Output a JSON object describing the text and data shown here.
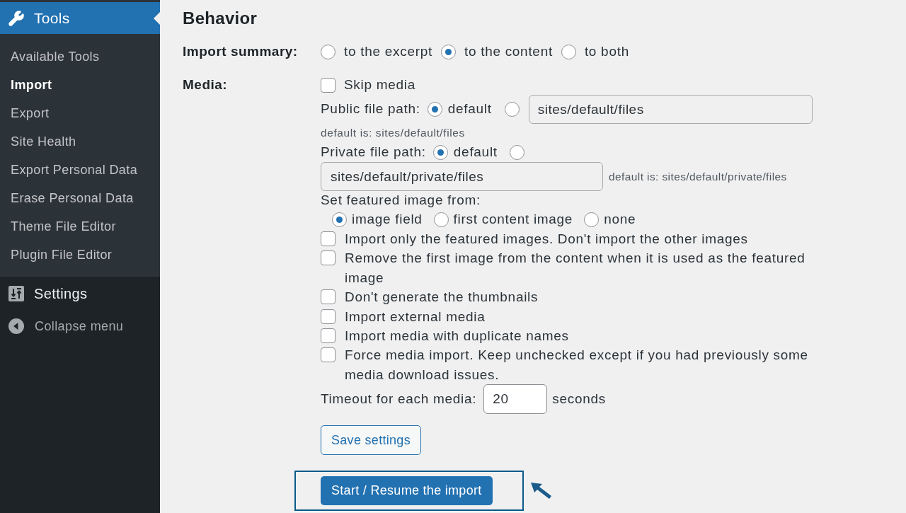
{
  "sidebar": {
    "menu_header": {
      "label": "Tools"
    },
    "submenu": [
      {
        "label": "Available Tools",
        "selected": false
      },
      {
        "label": "Import",
        "selected": true
      },
      {
        "label": "Export",
        "selected": false
      },
      {
        "label": "Site Health",
        "selected": false
      },
      {
        "label": "Export Personal Data",
        "selected": false
      },
      {
        "label": "Erase Personal Data",
        "selected": false
      },
      {
        "label": "Theme File Editor",
        "selected": false
      },
      {
        "label": "Plugin File Editor",
        "selected": false
      }
    ],
    "menu_items": [
      {
        "kind": "settings",
        "label": "Settings"
      },
      {
        "kind": "collapse",
        "label": "Collapse menu"
      }
    ]
  },
  "main": {
    "heading": "Behavior",
    "import_summary": {
      "label": "Import summary:",
      "options": [
        {
          "label": "to the excerpt",
          "selected": false
        },
        {
          "label": "to the content",
          "selected": true
        },
        {
          "label": "to both",
          "selected": false
        }
      ]
    },
    "media": {
      "label": "Media:",
      "skip_media": {
        "label": "Skip media",
        "checked": false
      },
      "public_file_path": {
        "label": "Public file path:",
        "default_option": {
          "label": "default",
          "selected": true
        },
        "custom_option": {
          "selected": false
        },
        "value": "sites/default/files",
        "hint": "default is: sites/default/files"
      },
      "private_file_path": {
        "label": "Private file path:",
        "default_option": {
          "label": "default",
          "selected": true
        },
        "custom_option": {
          "selected": false
        },
        "value": "sites/default/private/files",
        "hint": "default is: sites/default/private/files"
      },
      "featured_image": {
        "label": "Set featured image from:",
        "options": [
          {
            "label": "image field",
            "selected": true
          },
          {
            "label": "first content image",
            "selected": false
          },
          {
            "label": "none",
            "selected": false
          }
        ]
      },
      "options": [
        {
          "label": "Import only the featured images. Don't import the other images",
          "checked": false
        },
        {
          "label": "Remove the first image from the content when it is used as the featured image",
          "checked": false
        },
        {
          "label": "Don't generate the thumbnails",
          "checked": false
        },
        {
          "label": "Import external media",
          "checked": false
        },
        {
          "label": "Import media with duplicate names",
          "checked": false
        },
        {
          "label": "Force media import. Keep unchecked except if you had previously some media download issues.",
          "checked": false
        }
      ],
      "timeout": {
        "label": "Timeout for each media:",
        "value": "20",
        "unit": "seconds"
      }
    },
    "buttons": {
      "save": "Save settings",
      "start": "Start / Resume the import"
    }
  }
}
